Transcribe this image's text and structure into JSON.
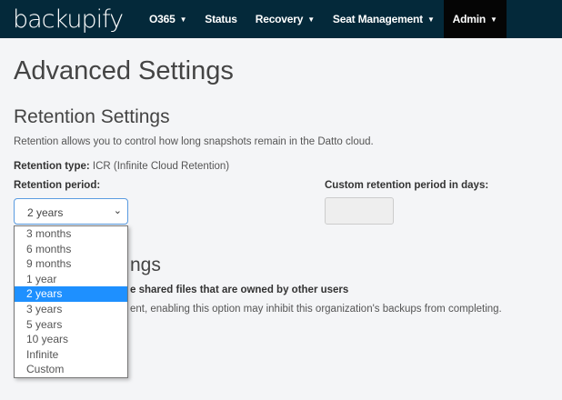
{
  "nav": {
    "logo": "backupify",
    "items": [
      {
        "label": "O365",
        "caret": true
      },
      {
        "label": "Status",
        "caret": false
      },
      {
        "label": "Recovery",
        "caret": true
      },
      {
        "label": "Seat Management",
        "caret": true
      },
      {
        "label": "Admin",
        "caret": true,
        "active": true
      }
    ]
  },
  "page": {
    "title": "Advanced Settings",
    "retention": {
      "heading": "Retention Settings",
      "description": "Retention allows you to control how long snapshots remain in the Datto cloud.",
      "type_label": "Retention type:",
      "type_value": "ICR (Infinite Cloud Retention)",
      "period_label": "Retention period:",
      "period_value": "2 years",
      "custom_label": "Custom retention period in days:",
      "custom_value": ""
    },
    "hidden_section": {
      "heading_fragment": "ngs",
      "option_fragment": "e shared files that are owned by other users",
      "note_fragment": "ent, enabling this option may inhibit this organization's backups from completing."
    }
  },
  "dropdown": {
    "options": [
      "3 months",
      "6 months",
      "9 months",
      "1 year",
      "2 years",
      "3 years",
      "5 years",
      "10 years",
      "Infinite",
      "Custom"
    ],
    "selected": "2 years"
  },
  "colors": {
    "nav_bg": "#04293a",
    "active_nav": "#050505",
    "highlight": "#1e90ff"
  }
}
